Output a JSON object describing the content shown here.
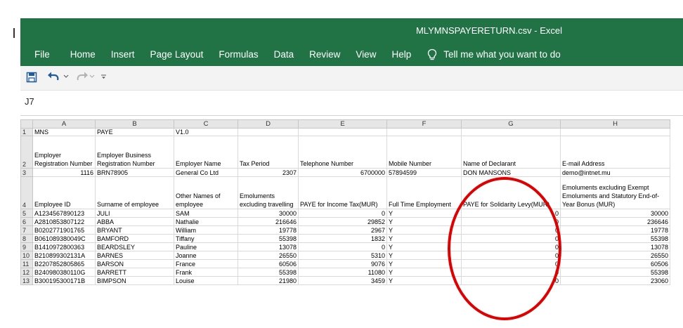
{
  "app": {
    "window_title": "MLYMNSPAYERETURN.csv  -  Excel",
    "brand_color": "#217346"
  },
  "menu": {
    "items": [
      "File",
      "Home",
      "Insert",
      "Page Layout",
      "Formulas",
      "Data",
      "Review",
      "View",
      "Help"
    ],
    "tell_me": "Tell me what you want to do"
  },
  "quick_access": {
    "icons": [
      "save-icon",
      "undo-icon",
      "redo-icon",
      "customize-icon"
    ]
  },
  "name_box": {
    "value": "J7"
  },
  "sheet": {
    "columns": [
      "A",
      "B",
      "C",
      "D",
      "E",
      "F",
      "G",
      "H"
    ],
    "rows": [
      {
        "n": "1",
        "cells": [
          "MNS",
          "PAYE",
          "V1.0",
          "",
          "",
          "",
          "",
          ""
        ]
      },
      {
        "n": "2",
        "cells": [
          "Employer Registration Number",
          "Employer Business Registration Number",
          "Employer Name",
          "Tax Period",
          "Telephone Number",
          "Mobile Number",
          "Name of Declarant",
          "E-mail Address"
        ]
      },
      {
        "n": "3",
        "cells": [
          "1116",
          "BRN78905",
          "General Co Ltd",
          "2307",
          "6700000",
          "57894599",
          "DON MANSONS",
          "demo@intnet.mu"
        ]
      },
      {
        "n": "4",
        "cells": [
          "Employee ID",
          "Surname of employee",
          "Other Names of employee",
          "Emoluments excluding travelling",
          "PAYE for Income Tax(MUR)",
          "Full Time Employment",
          "PAYE for Solidarity Levy(MUR)",
          "Emoluments excluding Exempt Emoluments and Statutory End-of-Year Bonus (MUR)"
        ]
      },
      {
        "n": "5",
        "cells": [
          "A1234567890123",
          "JULI",
          "SAM",
          "30000",
          "0",
          "Y",
          "0",
          "30000"
        ]
      },
      {
        "n": "6",
        "cells": [
          "A2810853807122",
          "ABBA",
          "Nathalie",
          "216646",
          "29852",
          "Y",
          "0",
          "236646"
        ]
      },
      {
        "n": "7",
        "cells": [
          "B0202771901765",
          "BRYANT",
          "William",
          "19778",
          "2967",
          "Y",
          "0",
          "19778"
        ]
      },
      {
        "n": "8",
        "cells": [
          "B061089380049C",
          "BAMFORD",
          "Tiffany",
          "55398",
          "1832",
          "Y",
          "0",
          "55398"
        ]
      },
      {
        "n": "9",
        "cells": [
          "B1410972800363",
          "BEARDSLEY",
          "Pauline",
          "13078",
          "0",
          "Y",
          "0",
          "13078"
        ]
      },
      {
        "n": "10",
        "cells": [
          "B210899302131A",
          "BARNES",
          "Joanne",
          "26550",
          "5310",
          "Y",
          "0",
          "26550"
        ]
      },
      {
        "n": "11",
        "cells": [
          "B2207852805865",
          "BARSON",
          "France",
          "60506",
          "9076",
          "Y",
          "0",
          "60506"
        ]
      },
      {
        "n": "12",
        "cells": [
          "B240980380110G",
          "BARRETT",
          "Frank",
          "55398",
          "11080",
          "Y",
          "0",
          "55398"
        ]
      },
      {
        "n": "13",
        "cells": [
          "B300195300171B",
          "BIMPSON",
          "Louise",
          "21980",
          "3459",
          "Y",
          "0",
          "23060"
        ]
      }
    ]
  },
  "annotation": {
    "color": "#e00000"
  }
}
